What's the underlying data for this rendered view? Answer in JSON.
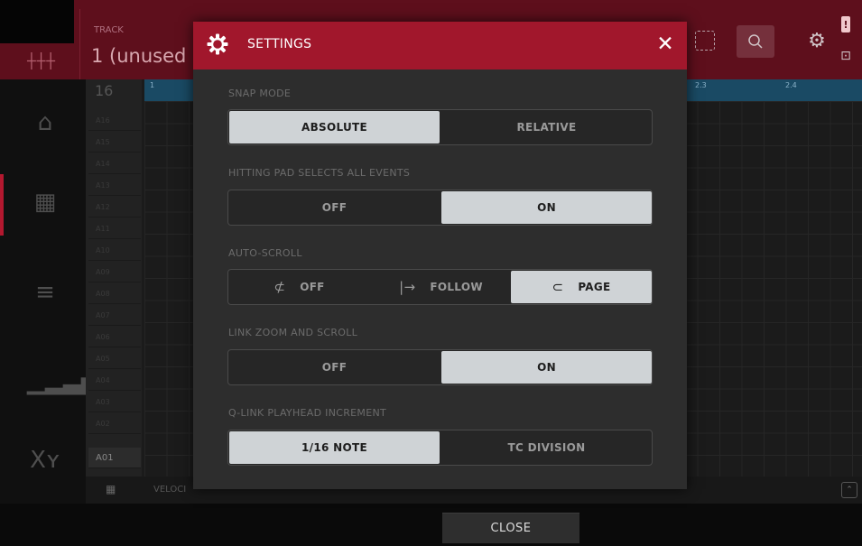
{
  "app": {
    "track_label": "TRACK",
    "track_name": "1  (unused",
    "pad_count": "16",
    "active_pad": "A01",
    "pad_rows": [
      "A16",
      "A15",
      "A14",
      "A13",
      "A12",
      "A11",
      "A10",
      "A09",
      "A08",
      "A07",
      "A06",
      "A05",
      "A04",
      "A03",
      "A02"
    ],
    "ruler_marks": [
      "1",
      "2.3",
      "2.4"
    ],
    "velocity_label": "VELOCI",
    "close_label": "CLOSE"
  },
  "settings": {
    "title": "SETTINGS",
    "close_glyph": "✕",
    "snap_mode": {
      "label": "SNAP MODE",
      "options": [
        "ABSOLUTE",
        "RELATIVE"
      ],
      "selected": "ABSOLUTE"
    },
    "hitting_pad": {
      "label": "HITTING PAD SELECTS ALL EVENTS",
      "options": [
        "OFF",
        "ON"
      ],
      "selected": "ON"
    },
    "auto_scroll": {
      "label": "AUTO-SCROLL",
      "options": [
        {
          "label": "OFF",
          "icon": "no-scroll-icon",
          "glyph": "⊄"
        },
        {
          "label": "FOLLOW",
          "icon": "follow-arrow-icon",
          "glyph": "|→"
        },
        {
          "label": "PAGE",
          "icon": "page-turn-icon",
          "glyph": "⊂"
        }
      ],
      "selected": "PAGE"
    },
    "link_zoom": {
      "label": "LINK ZOOM AND SCROLL",
      "options": [
        "OFF",
        "ON"
      ],
      "selected": "ON"
    },
    "qlink_increment": {
      "label": "Q-LINK PLAYHEAD INCREMENT",
      "options": [
        "1/16 NOTE",
        "TC DIVISION"
      ],
      "selected": "1/16 NOTE"
    }
  },
  "colors": {
    "header_red": "#a1172c",
    "selected_option": "#cfd3d6",
    "ruler_blue": "#1a4a64"
  }
}
